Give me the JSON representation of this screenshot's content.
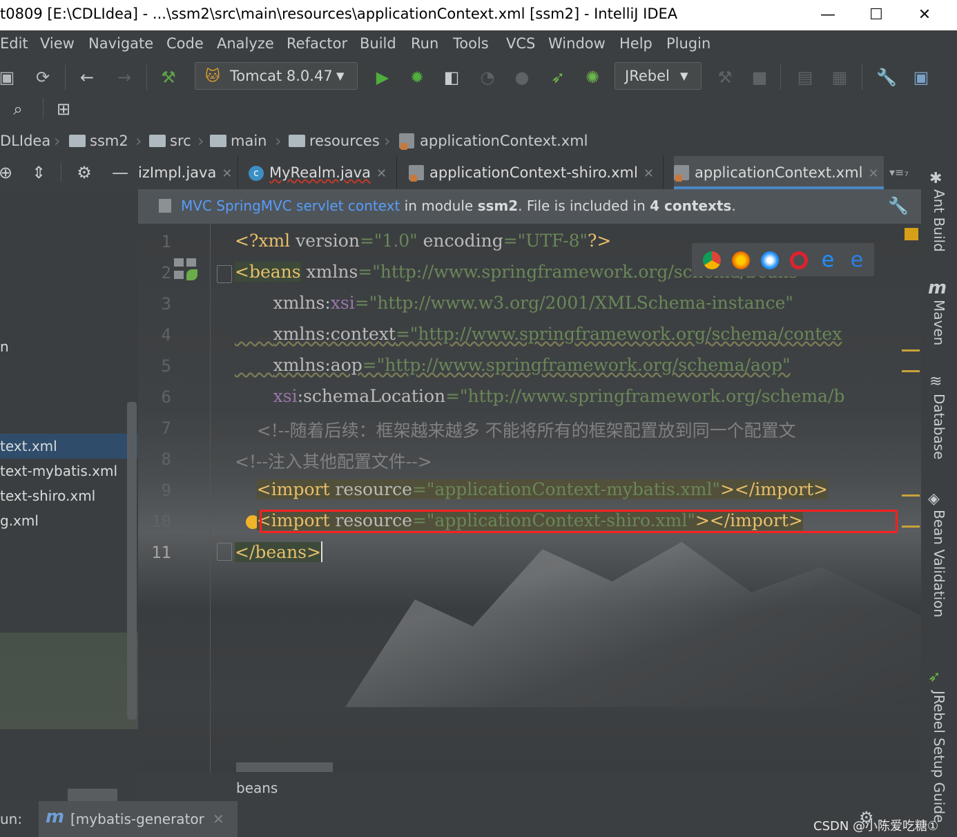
{
  "window": {
    "title": "t0809 [E:\\CDLIdea] - ...\\ssm2\\src\\main\\resources\\applicationContext.xml [ssm2] - IntelliJ IDEA",
    "minimize": "—",
    "maximize": "☐",
    "close": "✕"
  },
  "menu": [
    "Edit",
    "View",
    "Navigate",
    "Code",
    "Analyze",
    "Refactor",
    "Build",
    "Run",
    "Tools",
    "VCS",
    "Window",
    "Help",
    "Plugin"
  ],
  "toolbar": {
    "run_config": "Tomcat 8.0.47",
    "jrebel": "JRebel"
  },
  "breadcrumb": [
    "DLIdea",
    "ssm2",
    "src",
    "main",
    "resources",
    "applicationContext.xml"
  ],
  "project": {
    "partial_labels": [
      "n",
      "text.xml",
      "text-mybatis.xml",
      "text-shiro.xml",
      "g.xml"
    ]
  },
  "tabs": [
    {
      "label": "izImpl.java"
    },
    {
      "label": "MyRealm.java"
    },
    {
      "label": "applicationContext-shiro.xml"
    },
    {
      "label": "applicationContext.xml"
    }
  ],
  "notice": {
    "link": "MVC SpringMVC servlet context",
    "text1": " in module ",
    "module": "ssm2",
    "text2": ". File is included in ",
    "count": "4 contexts",
    "text3": "."
  },
  "editor": {
    "line_numbers": [
      "1",
      "2",
      "3",
      "4",
      "5",
      "6",
      "7",
      "8",
      "9",
      "10",
      "11"
    ],
    "lines": [
      "<?xml version=\"1.0\" encoding=\"UTF-8\"?>",
      "<beans xmlns=\"http://www.springframework.org/schema/beans\"",
      "       xmlns:xsi=\"http://www.w3.org/2001/XMLSchema-instance\"",
      "       xmlns:context=\"http://www.springframework.org/schema/contex",
      "       xmlns:aop=\"http://www.springframework.org/schema/aop\"",
      "       xsi:schemaLocation=\"http://www.springframework.org/schema/b",
      "    <!--随着后续：框架越来越多 不能将所有的框架配置放到同一个配置文",
      "<!--注入其他配置文件-->",
      "    <import resource=\"applicationContext-mybatis.xml\"></import>",
      "    <import resource=\"applicationContext-shiro.xml\"></import>",
      "</beans>"
    ]
  },
  "right_tools": [
    "Ant Build",
    "Maven",
    "Database",
    "Bean Validation",
    "JRebel Setup Guide"
  ],
  "bottom": {
    "crumb": "beans",
    "run_label": "un:",
    "run_tab": "[mybatis-generator",
    "watermark": "CSDN @小陈爱吃糖①"
  },
  "colors": {
    "tag": "#e8bf6a",
    "value": "#6a8759",
    "namespace": "#9876aa",
    "comment": "#808080",
    "highlight_box": "#ff2020",
    "link": "#589df6"
  }
}
